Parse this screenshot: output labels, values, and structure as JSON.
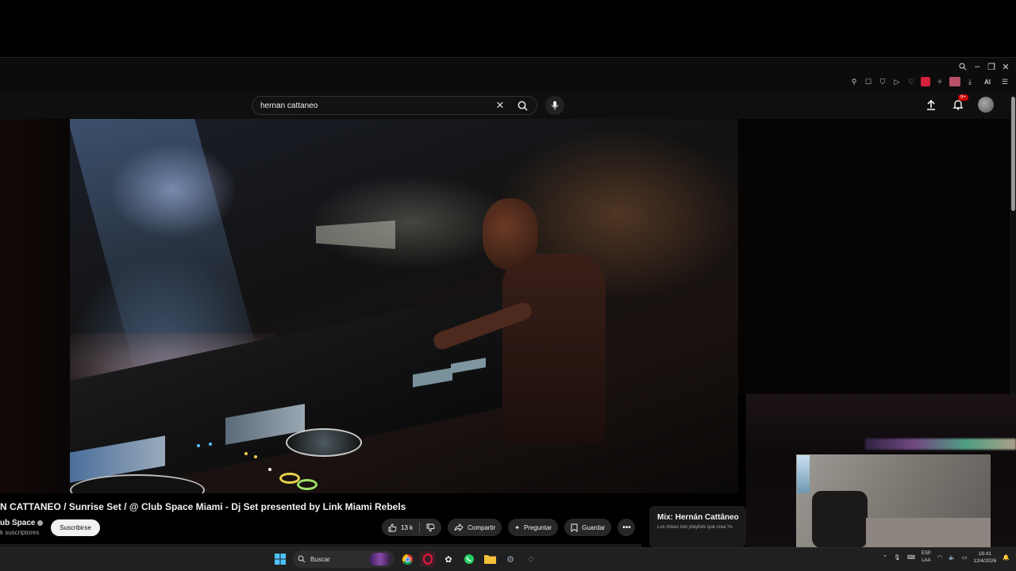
{
  "search": {
    "query": "hernan cattaneo"
  },
  "header": {
    "notification_count": "9+"
  },
  "video": {
    "title": "N CATTANEO / Sunrise Set / @ Club Space Miami - Dj Set presented by Link Miami Rebels",
    "channel": "ub Space",
    "subscribers": "k suscriptores",
    "subscribe_label": "Suscribirse",
    "likes": "13 k",
    "share_label": "Compartir",
    "ask_label": "Preguntar",
    "save_label": "Guardar"
  },
  "mix_card": {
    "title": "Mix: Hernán Cattâneo",
    "subtitle": "Los mixes son playlists que crea Yo"
  },
  "browser": {
    "ext_ai_label": "AI"
  },
  "taskbar": {
    "search_placeholder": "Buscar",
    "lang_top": "ESP",
    "lang_bottom": "LAA",
    "time": "18:41",
    "date": "12/4/2026"
  },
  "colors": {
    "accent": "#cc0000",
    "background": "#0f0f0f",
    "pill": "#272727"
  }
}
